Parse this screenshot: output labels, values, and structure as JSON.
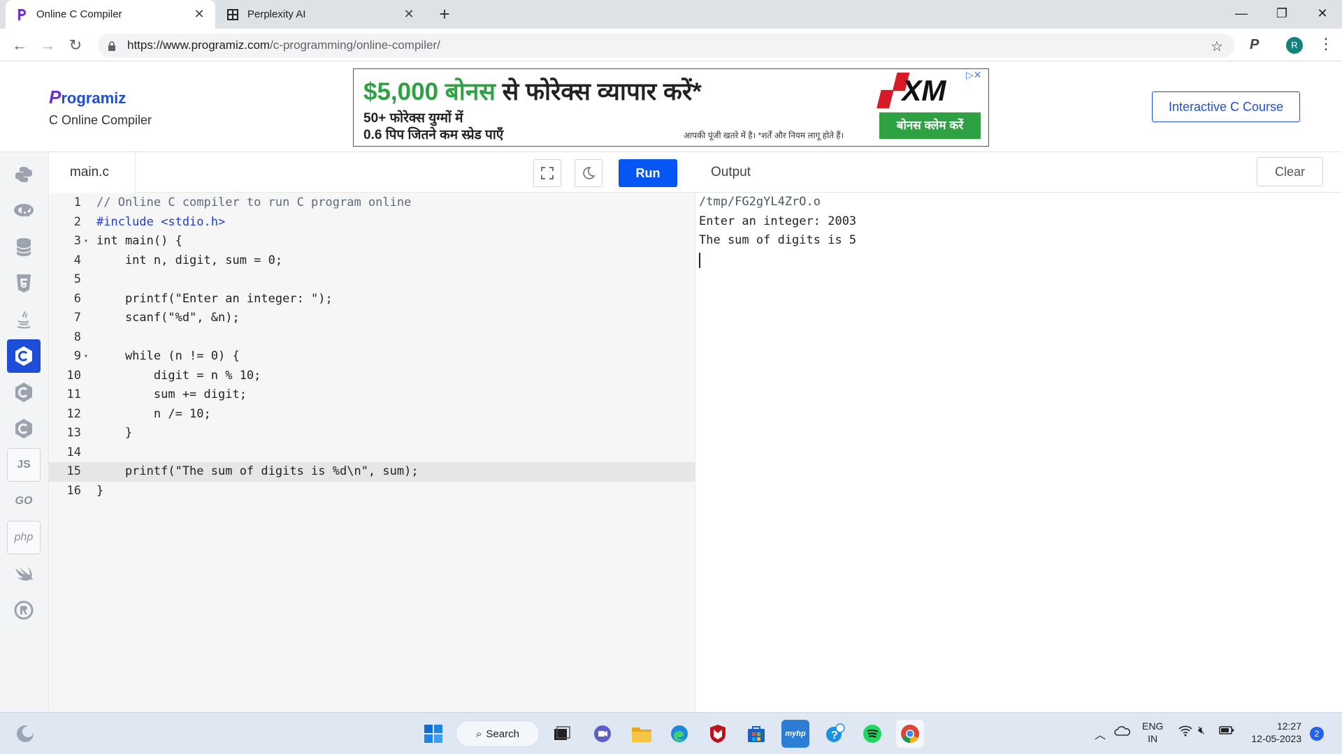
{
  "browser": {
    "tabs": [
      {
        "title": "Online C Compiler",
        "active": true
      },
      {
        "title": "Perplexity AI",
        "active": false
      }
    ],
    "url_host": "https://www.programiz.com",
    "url_path": "/c-programming/online-compiler/",
    "profile_initial": "R"
  },
  "header": {
    "logo": "rogramiz",
    "logo_letter": "P",
    "subtitle": "C Online Compiler",
    "course_button": "Interactive C Course"
  },
  "ad": {
    "headline_money": "$5,000 बोनस",
    "headline_rest": " से फोरेक्स व्यापार करें*",
    "line2": "50+ फोरेक्स युग्मों में",
    "line3": "0.6 पिप जितने कम स्प्रेड पाएँ",
    "disclaimer": "आपकी पूंजी खतरे में है। *शर्तें और नियम लागू होते हैं।",
    "brand": "XM",
    "cta": "बोनस क्लेम करें"
  },
  "sidebar": {
    "items": [
      {
        "name": "python",
        "label": "Py"
      },
      {
        "name": "r",
        "label": "R"
      },
      {
        "name": "sql",
        "label": "SQL"
      },
      {
        "name": "html",
        "label": "5"
      },
      {
        "name": "java",
        "label": "☕"
      },
      {
        "name": "c",
        "label": "C"
      },
      {
        "name": "cpp",
        "label": "C"
      },
      {
        "name": "csharp",
        "label": "C"
      },
      {
        "name": "js",
        "label": "JS"
      },
      {
        "name": "go",
        "label": "GO"
      },
      {
        "name": "php",
        "label": "php"
      },
      {
        "name": "swift",
        "label": "⟋"
      },
      {
        "name": "rust",
        "label": "R"
      }
    ]
  },
  "editor": {
    "filename": "main.c",
    "run_label": "Run",
    "lines": [
      "// Online C compiler to run C program online",
      "#include <stdio.h>",
      "int main() {",
      "    int n, digit, sum = 0;",
      "",
      "    printf(\"Enter an integer: \");",
      "    scanf(\"%d\", &n);",
      "",
      "    while (n != 0) {",
      "        digit = n % 10;",
      "        sum += digit;",
      "        n /= 10;",
      "    }",
      "",
      "    printf(\"The sum of digits is %d\\n\", sum);",
      "}"
    ],
    "line_numbers": [
      "1",
      "2",
      "3",
      "4",
      "5",
      "6",
      "7",
      "8",
      "9",
      "10",
      "11",
      "12",
      "13",
      "14",
      "15",
      "16"
    ],
    "highlighted_line": 15
  },
  "output": {
    "label": "Output",
    "clear_label": "Clear",
    "lines": [
      "/tmp/FG2gYL4ZrO.o",
      "Enter an integer: 2003",
      "The sum of digits is 5"
    ]
  },
  "taskbar": {
    "search_label": "Search",
    "lang_top": "ENG",
    "lang_bottom": "IN",
    "time": "12:27",
    "date": "12-05-2023",
    "notification_count": "2"
  }
}
